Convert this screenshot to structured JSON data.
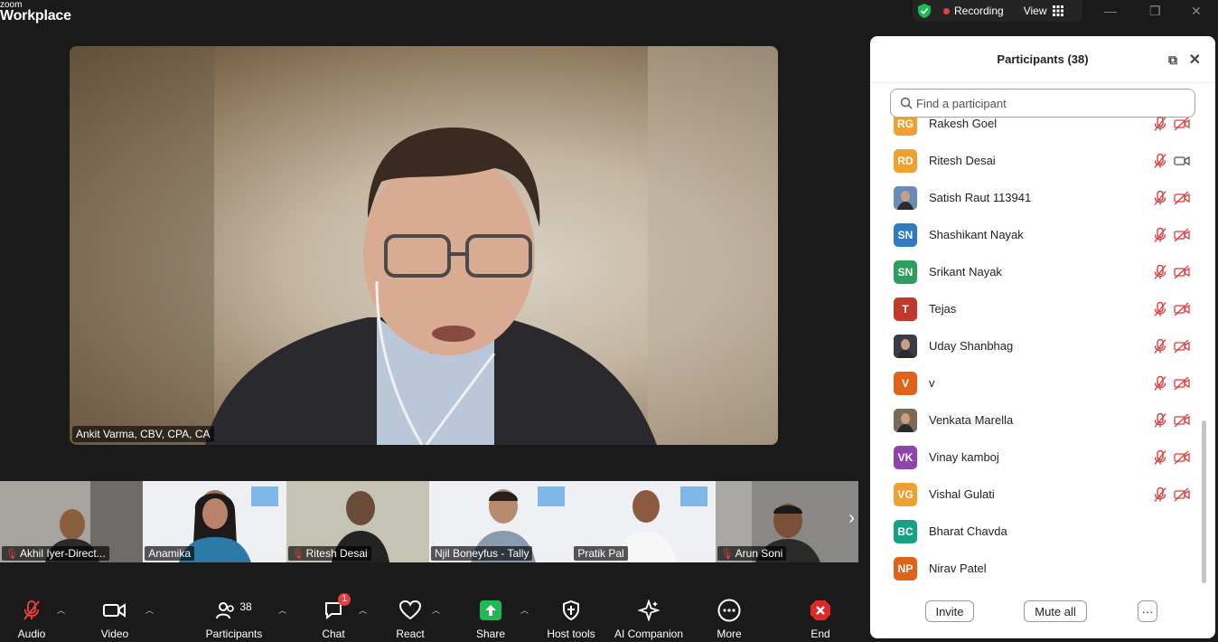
{
  "app": {
    "brand_small": "zoom",
    "brand_large": "Workplace"
  },
  "top": {
    "recording_label": "Recording",
    "view_label": "View"
  },
  "speaker": {
    "name": "Ankit Varma, CBV, CPA, CA"
  },
  "tiles": [
    {
      "name": "Akhil Iyer-Direct...",
      "muted": true
    },
    {
      "name": "Anamika",
      "muted": false
    },
    {
      "name": "Ritesh Desai",
      "muted": true
    },
    {
      "name": "Njil Boneyfus - Tally",
      "muted": false
    },
    {
      "name": "Pratik Pal",
      "muted": false
    },
    {
      "name": "Arun Soni",
      "muted": true
    }
  ],
  "toolbar": {
    "audio": "Audio",
    "video": "Video",
    "participants": "Participants",
    "participants_count": "38",
    "chat": "Chat",
    "chat_badge": "1",
    "react": "React",
    "share": "Share",
    "host_tools": "Host tools",
    "ai_companion": "AI Companion",
    "more": "More",
    "end": "End"
  },
  "panel": {
    "title": "Participants (38)",
    "search_placeholder": "Find a participant",
    "invite": "Invite",
    "mute_all": "Mute all",
    "more": "···",
    "participants": [
      {
        "initials": "RG",
        "name": "Rakesh Goel",
        "color": "#f0a030",
        "photo": false,
        "icons": true
      },
      {
        "initials": "RD",
        "name": "Ritesh Desai",
        "color": "#f0a030",
        "photo": false,
        "icons": true,
        "video_on": true
      },
      {
        "initials": "",
        "name": "Satish Raut 113941",
        "color": "#6a8db8",
        "photo": true,
        "icons": true
      },
      {
        "initials": "SN",
        "name": "Shashikant Nayak",
        "color": "#2e7bc4",
        "photo": false,
        "icons": true
      },
      {
        "initials": "SN",
        "name": "Srikant Nayak",
        "color": "#2e9e5e",
        "photo": false,
        "icons": true
      },
      {
        "initials": "T",
        "name": "Tejas",
        "color": "#c0392b",
        "photo": false,
        "icons": true
      },
      {
        "initials": "",
        "name": "Uday Shanbhag",
        "color": "#3a3a4a",
        "photo": true,
        "icons": true
      },
      {
        "initials": "V",
        "name": "v",
        "color": "#e0631a",
        "photo": false,
        "icons": true
      },
      {
        "initials": "",
        "name": "Venkata Marella",
        "color": "#7a6a5a",
        "photo": true,
        "icons": true
      },
      {
        "initials": "VK",
        "name": "Vinay kamboj",
        "color": "#8e44ad",
        "photo": false,
        "icons": true
      },
      {
        "initials": "VG",
        "name": "Vishal Gulati",
        "color": "#f0a030",
        "photo": false,
        "icons": true
      },
      {
        "initials": "BC",
        "name": "Bharat Chavda",
        "color": "#16a085",
        "photo": false,
        "icons": false
      },
      {
        "initials": "NP",
        "name": "Nirav Patel",
        "color": "#e0631a",
        "photo": false,
        "icons": false
      }
    ]
  }
}
